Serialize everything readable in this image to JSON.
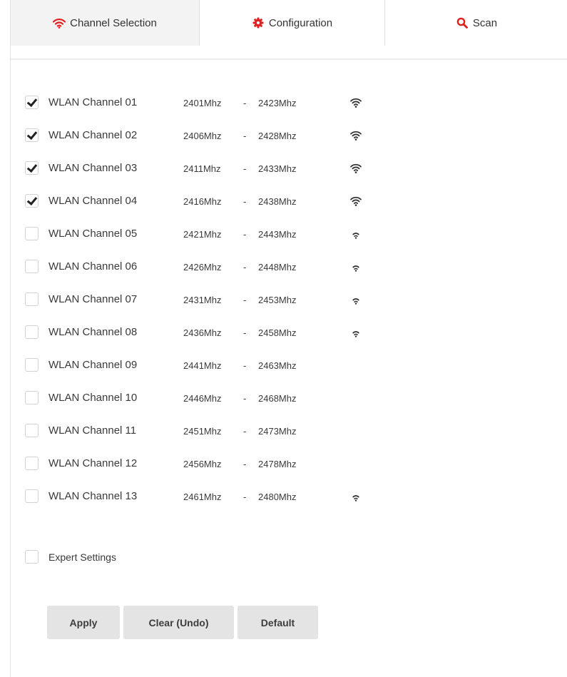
{
  "tabs": [
    {
      "label": "Channel Selection",
      "icon": "wifi-icon",
      "active": true,
      "icon_color": "#e02020"
    },
    {
      "label": "Configuration",
      "icon": "gear-icon",
      "active": false,
      "icon_color": "#e02020"
    },
    {
      "label": "Scan",
      "icon": "search-icon",
      "active": false,
      "icon_color": "#e02020"
    }
  ],
  "channels": [
    {
      "name": "WLAN Channel 01",
      "start": "2401Mhz",
      "end": "2423Mhz",
      "checked": true,
      "signal": "strong"
    },
    {
      "name": "WLAN Channel 02",
      "start": "2406Mhz",
      "end": "2428Mhz",
      "checked": true,
      "signal": "strong"
    },
    {
      "name": "WLAN Channel 03",
      "start": "2411Mhz",
      "end": "2433Mhz",
      "checked": true,
      "signal": "strong"
    },
    {
      "name": "WLAN Channel 04",
      "start": "2416Mhz",
      "end": "2438Mhz",
      "checked": true,
      "signal": "strong"
    },
    {
      "name": "WLAN Channel 05",
      "start": "2421Mhz",
      "end": "2443Mhz",
      "checked": false,
      "signal": "weak"
    },
    {
      "name": "WLAN Channel 06",
      "start": "2426Mhz",
      "end": "2448Mhz",
      "checked": false,
      "signal": "weak"
    },
    {
      "name": "WLAN Channel 07",
      "start": "2431Mhz",
      "end": "2453Mhz",
      "checked": false,
      "signal": "weak"
    },
    {
      "name": "WLAN Channel 08",
      "start": "2436Mhz",
      "end": "2458Mhz",
      "checked": false,
      "signal": "weak"
    },
    {
      "name": "WLAN Channel 09",
      "start": "2441Mhz",
      "end": "2463Mhz",
      "checked": false,
      "signal": "none"
    },
    {
      "name": "WLAN Channel 10",
      "start": "2446Mhz",
      "end": "2468Mhz",
      "checked": false,
      "signal": "none"
    },
    {
      "name": "WLAN Channel 11",
      "start": "2451Mhz",
      "end": "2473Mhz",
      "checked": false,
      "signal": "none"
    },
    {
      "name": "WLAN Channel 12",
      "start": "2456Mhz",
      "end": "2478Mhz",
      "checked": false,
      "signal": "none"
    },
    {
      "name": "WLAN Channel 13",
      "start": "2461Mhz",
      "end": "2480Mhz",
      "checked": false,
      "signal": "weak"
    }
  ],
  "range_separator": "-",
  "expert": {
    "label": "Expert Settings",
    "checked": false
  },
  "buttons": {
    "apply": "Apply",
    "clear": "Clear (Undo)",
    "default": "Default"
  }
}
